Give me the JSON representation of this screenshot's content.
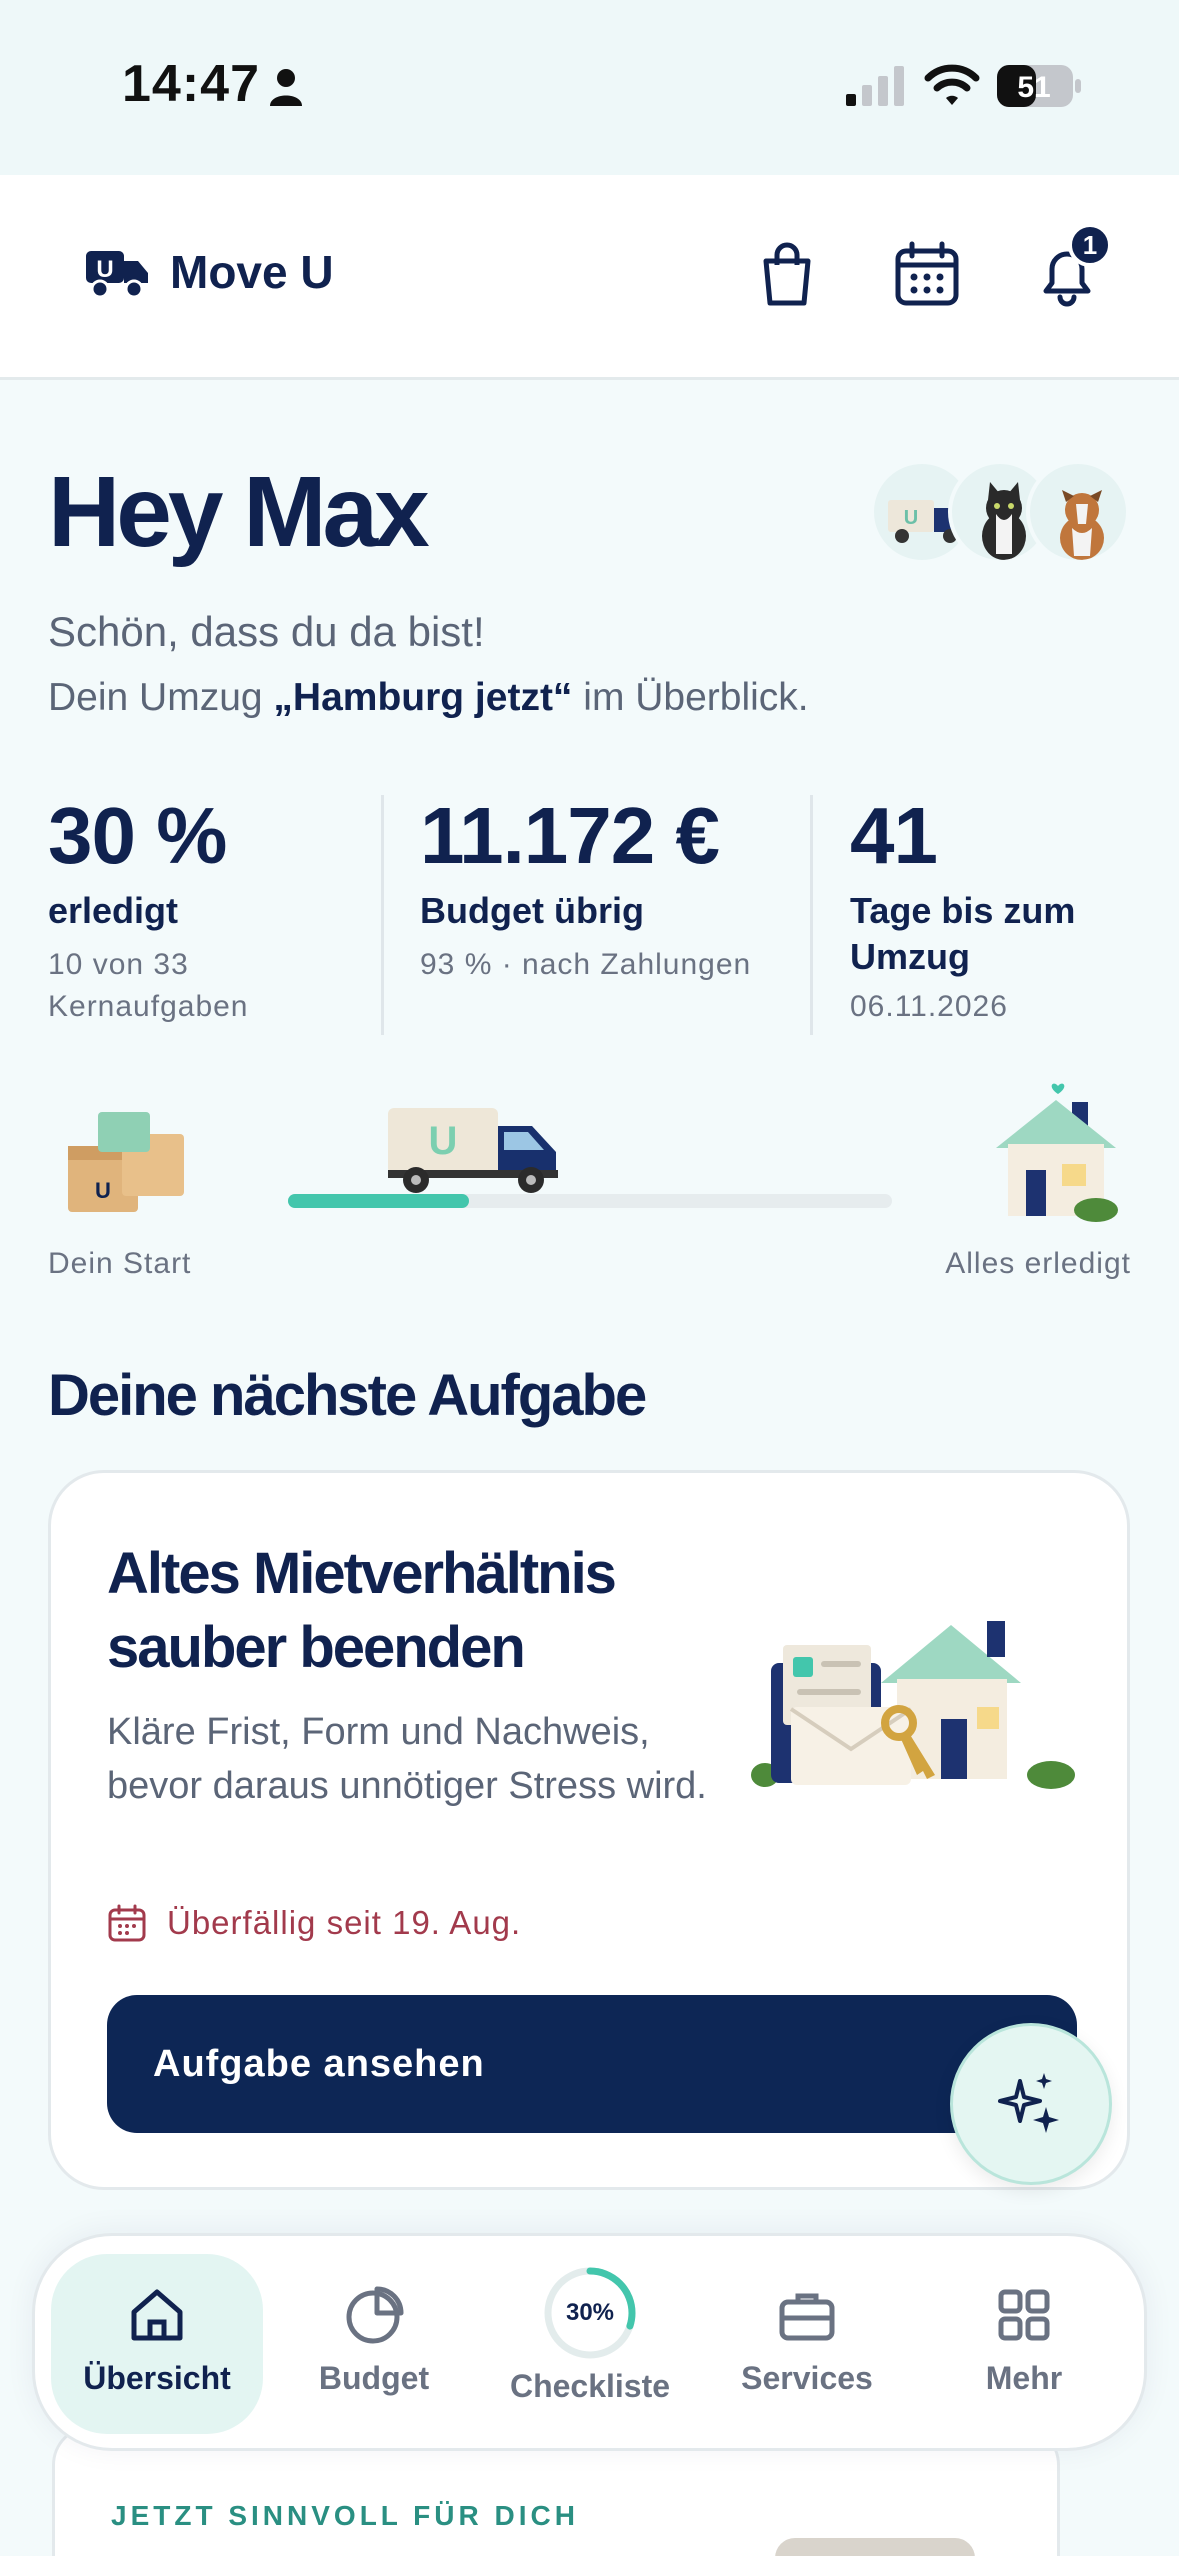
{
  "status_bar": {
    "time": "14:47",
    "battery": "51"
  },
  "header": {
    "brand": "Move U",
    "notification_count": "1"
  },
  "greeting": {
    "title": "Hey Max",
    "subtitle": "Schön, dass du da bist!",
    "line_prefix": "Dein Umzug ",
    "move_name": "„Hamburg jetzt“",
    "line_suffix": " im Überblick."
  },
  "stats": [
    {
      "value": "30 %",
      "label": "erledigt",
      "note": "10 von 33 Kernaufgaben"
    },
    {
      "value": "11.172 €",
      "label": "Budget übrig",
      "note": "93 % · nach Zahlungen"
    },
    {
      "value": "41",
      "label": "Tage bis zum Umzug",
      "note": "06.11.2026"
    }
  ],
  "progress": {
    "start_label": "Dein Start",
    "end_label": "Alles erledigt",
    "fraction": 0.3
  },
  "next_task": {
    "section_title": "Deine nächste Aufgabe",
    "title": "Altes Mietverhältnis sauber beenden",
    "description": "Kläre Frist, Form und Nachweis, bevor daraus unnötiger Stress wird.",
    "due": "Überfällig seit 19. Aug.",
    "button": "Aufgabe ansehen"
  },
  "peek_card": {
    "label": "JETZT SINNVOLL FÜR DICH"
  },
  "bottom_nav": {
    "items": [
      {
        "label": "Übersicht",
        "icon": "home-icon",
        "active": true
      },
      {
        "label": "Budget",
        "icon": "pie-chart-icon",
        "active": false
      },
      {
        "label": "Checkliste",
        "icon": "progress-ring-icon",
        "ring_text": "30%",
        "active": false
      },
      {
        "label": "Services",
        "icon": "briefcase-icon",
        "active": false
      },
      {
        "label": "Mehr",
        "icon": "grid-icon",
        "active": false
      }
    ]
  },
  "colors": {
    "navy": "#10224f",
    "button": "#0d2655",
    "accent": "#43c6ac",
    "overdue": "#a23a4c"
  }
}
